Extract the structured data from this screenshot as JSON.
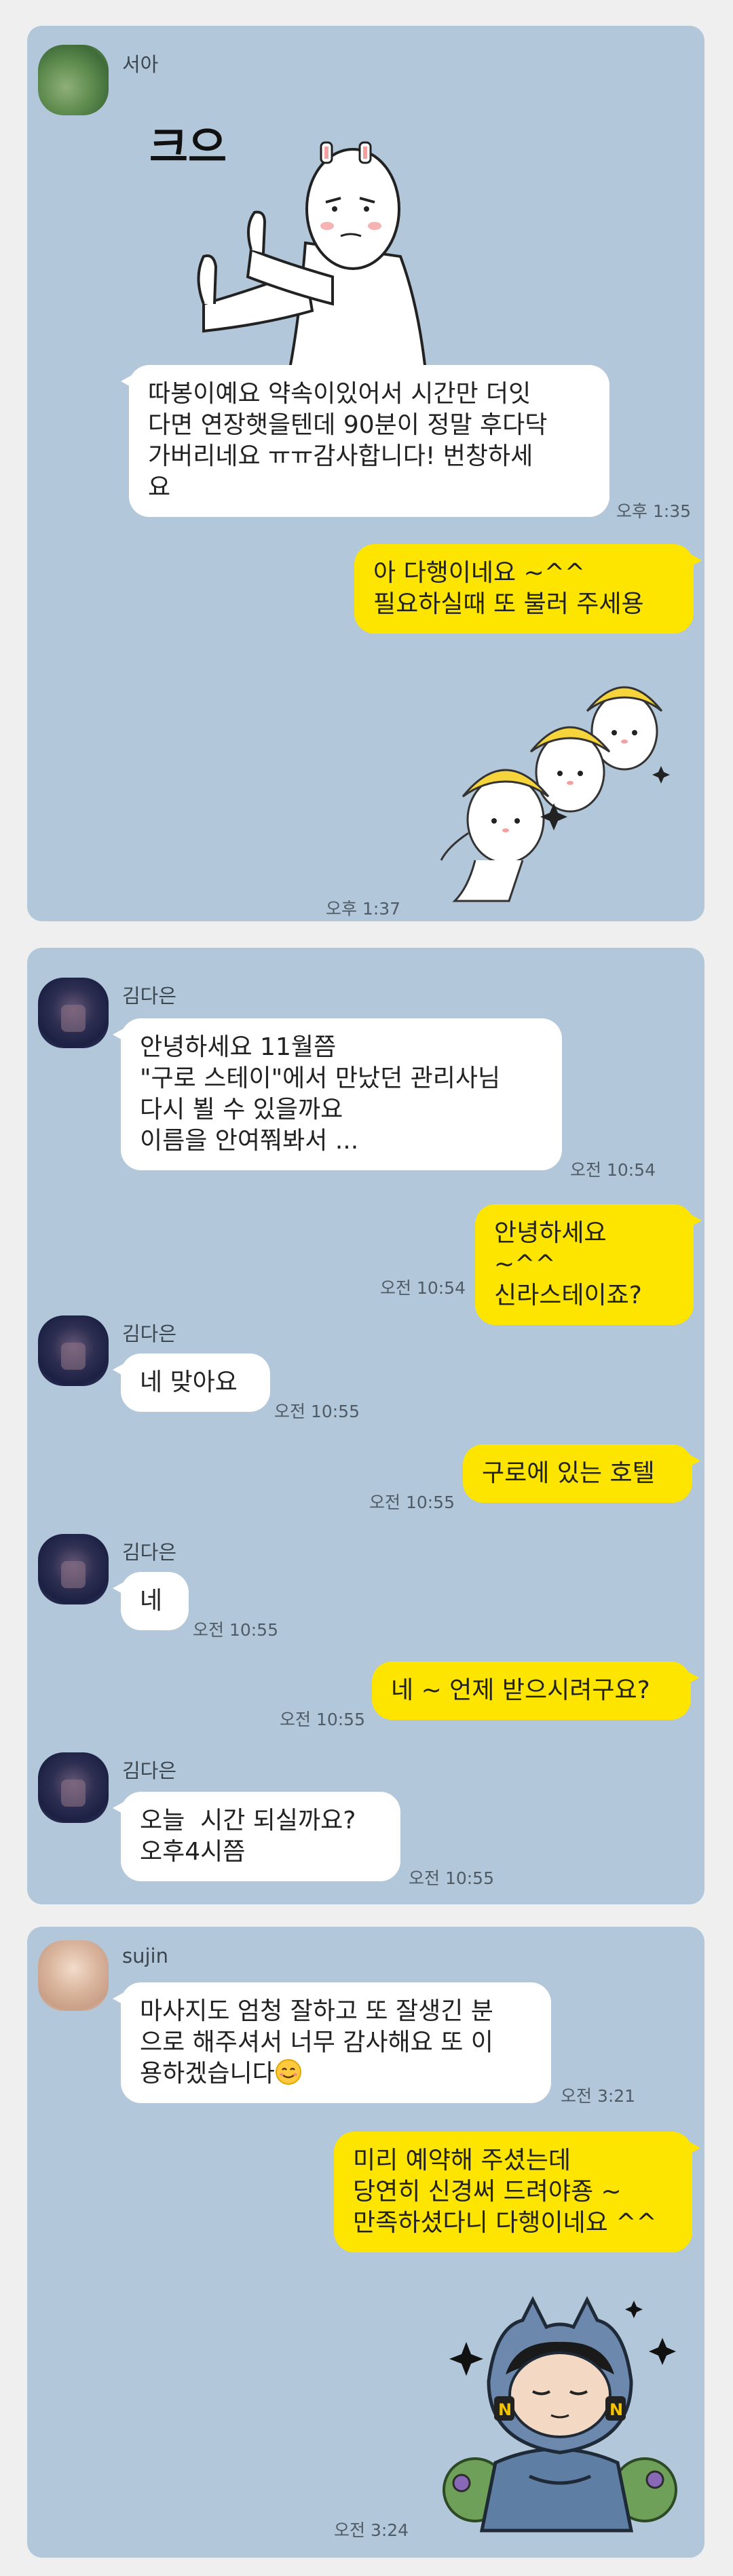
{
  "panel1": {
    "sender": "서아",
    "sticker_caption": "크으",
    "message": "따봉이예요 약속이있어서 시간만 더잇\n다면 연장햇을텐데 90분이 정말 후다닥\n가버리네요 ㅠㅠ감사합니다! 번창하세\n요",
    "message_time": "오후 1:35",
    "reply": "아 다행이네요 ~^^\n필요하실때 또 불러 주세용",
    "sticker_time": "오후 1:37"
  },
  "panel2": {
    "sender": "김다은",
    "messages": [
      {
        "text": "안녕하세요 11월쯤\n\"구로 스테이\"에서 만났던 관리사님\n다시 뵐 수 있을까요\n이름을 안여쭤봐서 ...",
        "time": "오전 10:54"
      },
      {
        "text": "안녕하세요 ~^^\n신라스테이죠?",
        "time": "오전 10:54"
      },
      {
        "text": "네 맞아요",
        "time": "오전 10:55"
      },
      {
        "text": "구로에 있는 호텔",
        "time": "오전 10:55"
      },
      {
        "text": "네",
        "time": "오전 10:55"
      },
      {
        "text": "네 ~ 언제 받으시려구요?",
        "time": "오전 10:55"
      },
      {
        "text": "오늘  시간 되실까요?\n오후4시쯤",
        "time": "오전 10:55"
      }
    ]
  },
  "panel3": {
    "sender": "sujin",
    "message": "마사지도 엄청 잘하고 또 잘생긴 분\n으로 해주셔서 너무 감사해요 또 이\n용하겠습니다",
    "message_time": "오전 3:21",
    "reply": "미리 예약해 주셨는데\n당연히 신경써 드려야죵 ~\n만족하셨다니 다행이네요 ^^",
    "sticker_time": "오전 3:24"
  },
  "colors": {
    "chat_background": "#b2c7d9",
    "incoming_bubble": "#ffffff",
    "outgoing_bubble": "#fee500",
    "page_background": "#efefef"
  }
}
